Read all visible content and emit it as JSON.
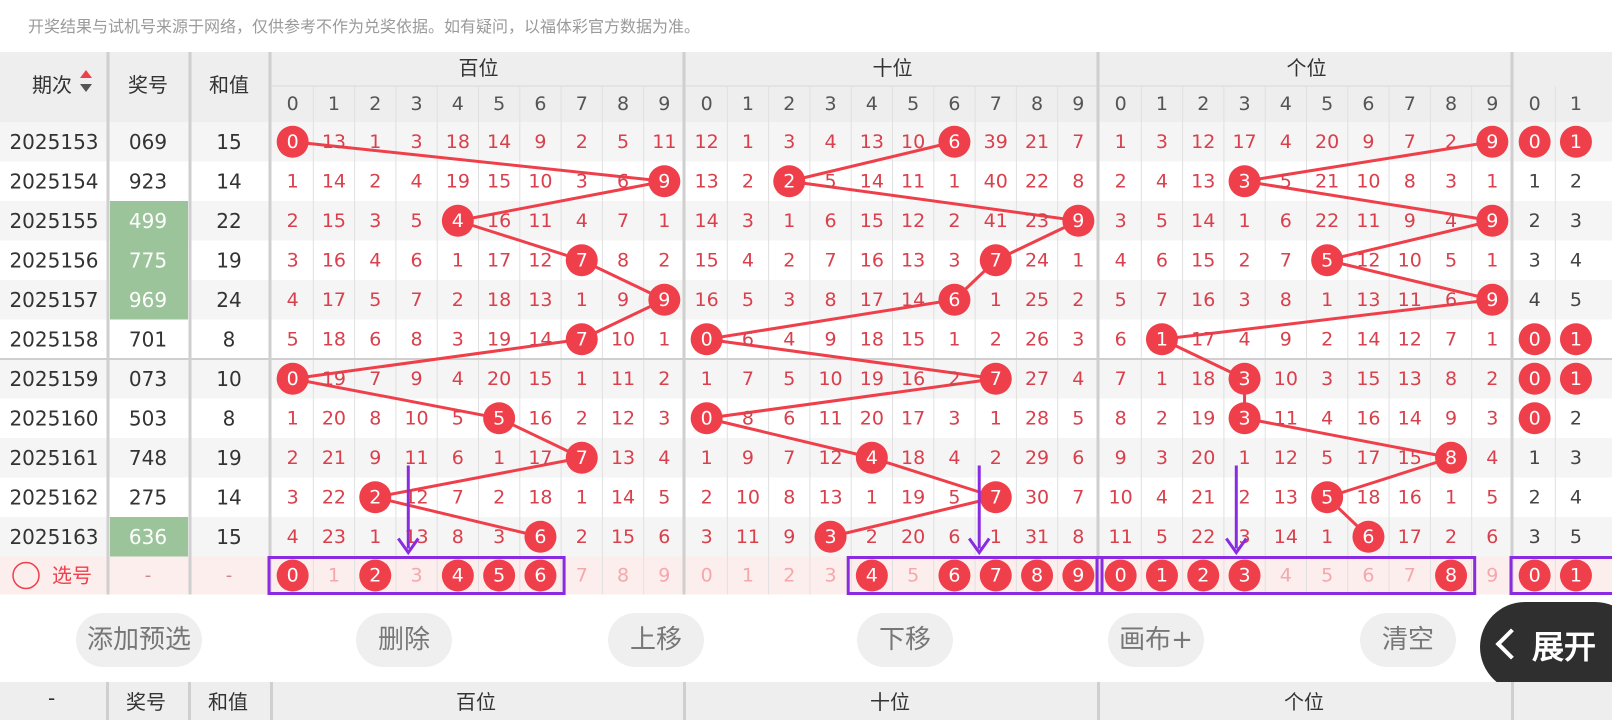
{
  "disclaimer": "开奖结果与试机号来源于网络，仅供参考不作为兑奖依据。如有疑问，以福体彩官方数据为准。",
  "header": {
    "period": "期次",
    "prize": "奖号",
    "sum": "和值",
    "groups": [
      "百位",
      "十位",
      "个位"
    ],
    "digits": [
      "0",
      "1",
      "2",
      "3",
      "4",
      "5",
      "6",
      "7",
      "8",
      "9"
    ],
    "extra_digits": [
      "0",
      "1"
    ]
  },
  "rows": [
    {
      "period": "2025153",
      "prize": "069",
      "sum": "15",
      "highlight": false,
      "b": [
        "0",
        "13",
        "1",
        "3",
        "18",
        "14",
        "9",
        "2",
        "5",
        "11"
      ],
      "s": [
        "12",
        "1",
        "3",
        "4",
        "13",
        "10",
        "6",
        "39",
        "21",
        "7"
      ],
      "g": [
        "1",
        "3",
        "12",
        "17",
        "4",
        "20",
        "9",
        "7",
        "2",
        "9"
      ],
      "e": [
        "0",
        "1"
      ]
    },
    {
      "period": "2025154",
      "prize": "923",
      "sum": "14",
      "highlight": false,
      "b": [
        "1",
        "14",
        "2",
        "4",
        "19",
        "15",
        "10",
        "3",
        "6",
        "9"
      ],
      "s": [
        "13",
        "2",
        "2",
        "5",
        "14",
        "11",
        "1",
        "40",
        "22",
        "8"
      ],
      "g": [
        "2",
        "4",
        "13",
        "3",
        "5",
        "21",
        "10",
        "8",
        "3",
        "1"
      ],
      "e": [
        "1",
        "2"
      ]
    },
    {
      "period": "2025155",
      "prize": "499",
      "sum": "22",
      "highlight": true,
      "b": [
        "2",
        "15",
        "3",
        "5",
        "4",
        "16",
        "11",
        "4",
        "7",
        "1"
      ],
      "s": [
        "14",
        "3",
        "1",
        "6",
        "15",
        "12",
        "2",
        "41",
        "23",
        "9"
      ],
      "g": [
        "3",
        "5",
        "14",
        "1",
        "6",
        "22",
        "11",
        "9",
        "4",
        "9"
      ],
      "e": [
        "2",
        "3"
      ]
    },
    {
      "period": "2025156",
      "prize": "775",
      "sum": "19",
      "highlight": true,
      "b": [
        "3",
        "16",
        "4",
        "6",
        "1",
        "17",
        "12",
        "7",
        "8",
        "2"
      ],
      "s": [
        "15",
        "4",
        "2",
        "7",
        "16",
        "13",
        "3",
        "7",
        "24",
        "1"
      ],
      "g": [
        "4",
        "6",
        "15",
        "2",
        "7",
        "5",
        "12",
        "10",
        "5",
        "1"
      ],
      "e": [
        "3",
        "4"
      ]
    },
    {
      "period": "2025157",
      "prize": "969",
      "sum": "24",
      "highlight": true,
      "b": [
        "4",
        "17",
        "5",
        "7",
        "2",
        "18",
        "13",
        "1",
        "9",
        "9"
      ],
      "s": [
        "16",
        "5",
        "3",
        "8",
        "17",
        "14",
        "6",
        "1",
        "25",
        "2"
      ],
      "g": [
        "5",
        "7",
        "16",
        "3",
        "8",
        "1",
        "13",
        "11",
        "6",
        "9"
      ],
      "e": [
        "4",
        "5"
      ]
    },
    {
      "period": "2025158",
      "prize": "701",
      "sum": "8",
      "highlight": false,
      "b": [
        "5",
        "18",
        "6",
        "8",
        "3",
        "19",
        "14",
        "7",
        "10",
        "1"
      ],
      "s": [
        "0",
        "6",
        "4",
        "9",
        "18",
        "15",
        "1",
        "2",
        "26",
        "3"
      ],
      "g": [
        "6",
        "1",
        "17",
        "4",
        "9",
        "2",
        "14",
        "12",
        "7",
        "1"
      ],
      "e": [
        "0",
        "1"
      ]
    },
    {
      "period": "2025159",
      "prize": "073",
      "sum": "10",
      "highlight": false,
      "b": [
        "0",
        "19",
        "7",
        "9",
        "4",
        "20",
        "15",
        "1",
        "11",
        "2"
      ],
      "s": [
        "1",
        "7",
        "5",
        "10",
        "19",
        "16",
        "2",
        "7",
        "27",
        "4"
      ],
      "g": [
        "7",
        "1",
        "18",
        "3",
        "10",
        "3",
        "15",
        "13",
        "8",
        "2"
      ],
      "e": [
        "0",
        "1"
      ]
    },
    {
      "period": "2025160",
      "prize": "503",
      "sum": "8",
      "highlight": false,
      "b": [
        "1",
        "20",
        "8",
        "10",
        "5",
        "5",
        "16",
        "2",
        "12",
        "3"
      ],
      "s": [
        "0",
        "8",
        "6",
        "11",
        "20",
        "17",
        "3",
        "1",
        "28",
        "5"
      ],
      "g": [
        "8",
        "2",
        "19",
        "3",
        "11",
        "4",
        "16",
        "14",
        "9",
        "3"
      ],
      "e": [
        "0",
        "2"
      ]
    },
    {
      "period": "2025161",
      "prize": "748",
      "sum": "19",
      "highlight": false,
      "b": [
        "2",
        "21",
        "9",
        "11",
        "6",
        "1",
        "17",
        "7",
        "13",
        "4"
      ],
      "s": [
        "1",
        "9",
        "7",
        "12",
        "4",
        "18",
        "4",
        "2",
        "29",
        "6"
      ],
      "g": [
        "9",
        "3",
        "20",
        "1",
        "12",
        "5",
        "17",
        "15",
        "8",
        "4"
      ],
      "e": [
        "1",
        "3"
      ]
    },
    {
      "period": "2025162",
      "prize": "275",
      "sum": "14",
      "highlight": false,
      "b": [
        "3",
        "22",
        "2",
        "12",
        "7",
        "2",
        "18",
        "1",
        "14",
        "5"
      ],
      "s": [
        "2",
        "10",
        "8",
        "13",
        "1",
        "19",
        "5",
        "7",
        "30",
        "7"
      ],
      "g": [
        "10",
        "4",
        "21",
        "2",
        "13",
        "5",
        "18",
        "16",
        "1",
        "5"
      ],
      "e": [
        "2",
        "4"
      ]
    },
    {
      "period": "2025163",
      "prize": "636",
      "sum": "15",
      "highlight": true,
      "b": [
        "4",
        "23",
        "1",
        "13",
        "8",
        "3",
        "6",
        "2",
        "15",
        "6"
      ],
      "s": [
        "3",
        "11",
        "9",
        "3",
        "2",
        "20",
        "6",
        "1",
        "31",
        "8"
      ],
      "g": [
        "11",
        "5",
        "22",
        "3",
        "14",
        "1",
        "6",
        "17",
        "2",
        "6"
      ],
      "e": [
        "3",
        "5"
      ]
    }
  ],
  "hits": {
    "b": [
      0,
      9,
      4,
      7,
      9,
      7,
      0,
      5,
      7,
      2,
      6
    ],
    "s": [
      6,
      2,
      9,
      7,
      6,
      0,
      7,
      0,
      4,
      7,
      3
    ],
    "g": [
      9,
      3,
      9,
      5,
      9,
      1,
      3,
      3,
      8,
      5,
      6
    ]
  },
  "selection": {
    "label": "选号",
    "dash1": "-",
    "dash2": "-",
    "b_selected": [
      0,
      2,
      4,
      5,
      6
    ],
    "s_selected": [
      4,
      6,
      7,
      8,
      9
    ],
    "g_selected": [
      0,
      1,
      2,
      3,
      8
    ],
    "e_selected": [
      0,
      1
    ]
  },
  "toolbar": {
    "add": "添加预选",
    "delete": "删除",
    "up": "上移",
    "down": "下移",
    "canvas": "画布+",
    "clear": "清空",
    "expand": "展开"
  },
  "header2": {
    "dash": "-",
    "prize": "奖号",
    "sum": "和值",
    "groups": [
      "百位",
      "十位",
      "个位"
    ]
  },
  "colors": {
    "ball": "#ef3f4a",
    "line": "#ef3f4a",
    "miss_text": "#d9404c",
    "highlight_cell": "#9cc49a",
    "header_bg": "#eeeeee",
    "select_row_bg": "#fdeeee",
    "select_box": "#8a2be2",
    "arrow": "#8a2be2"
  }
}
